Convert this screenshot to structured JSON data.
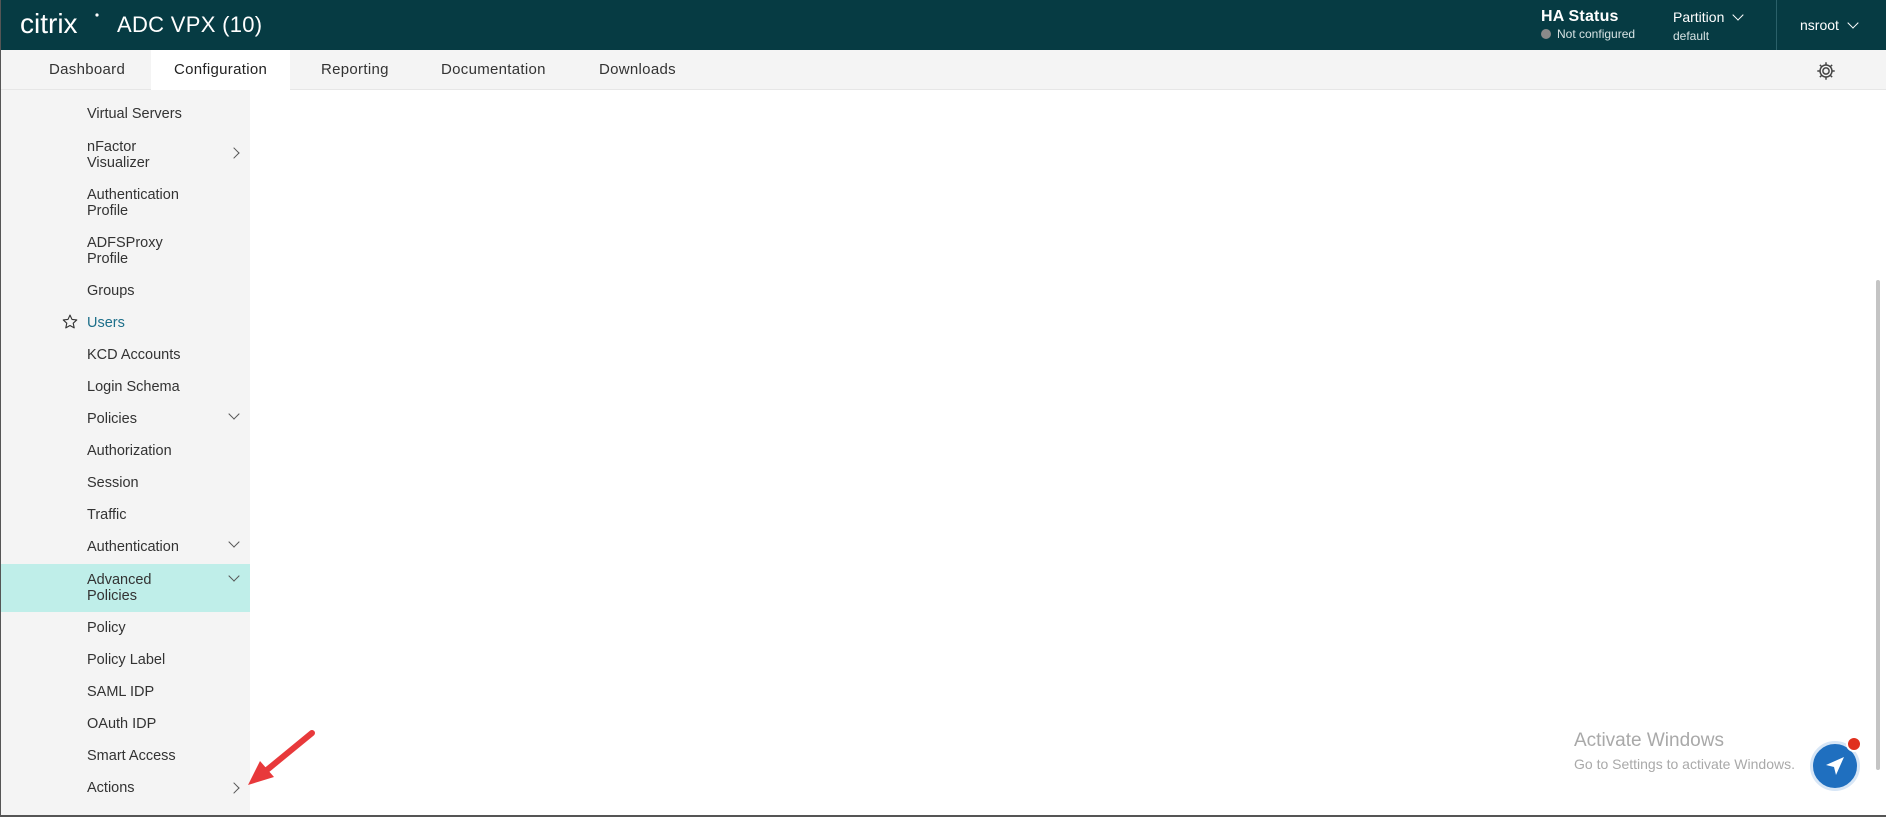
{
  "header": {
    "logo_text": "citrix",
    "app_title": "ADC VPX (10)",
    "ha_status_label": "HA Status",
    "ha_status_value": "Not configured",
    "partition_label": "Partition",
    "partition_value": "default",
    "user": "nsroot"
  },
  "nav": {
    "tabs": [
      {
        "label": "Dashboard"
      },
      {
        "label": "Configuration"
      },
      {
        "label": "Reporting"
      },
      {
        "label": "Documentation"
      },
      {
        "label": "Downloads"
      }
    ],
    "active_tab": "Configuration",
    "settings_icon": "gear-icon"
  },
  "sidebar": {
    "items": [
      {
        "label": "Virtual Servers"
      },
      {
        "label": "nFactor Visualizer",
        "expander": "chevron-right-icon"
      },
      {
        "label": "Authentication Profile"
      },
      {
        "label": "ADFSProxy Profile"
      },
      {
        "label": "Groups"
      },
      {
        "label": "Users",
        "state": "active",
        "icon": "star-icon"
      },
      {
        "label": "KCD Accounts"
      },
      {
        "label": "Login Schema"
      },
      {
        "label": "Policies",
        "expander": "chevron-down-icon"
      },
      {
        "label": "Authorization"
      },
      {
        "label": "Session"
      },
      {
        "label": "Traffic"
      },
      {
        "label": "Authentication",
        "expander": "chevron-down-icon"
      },
      {
        "label": "Advanced Policies",
        "expander": "chevron-down-icon",
        "state": "selected"
      },
      {
        "label": "Policy"
      },
      {
        "label": "Policy Label"
      },
      {
        "label": "SAML IDP"
      },
      {
        "label": "OAuth IDP"
      },
      {
        "label": "Smart Access"
      },
      {
        "label": "Actions",
        "expander": "chevron-right-icon"
      }
    ]
  },
  "watermark": {
    "title": "Activate Windows",
    "subtitle": "Go to Settings to activate Windows."
  },
  "colors": {
    "header_bg": "#063b43",
    "selected_item_bg": "#bfeee9",
    "active_item_text": "#1d6f8a",
    "fab_bg": "#1f6fbf",
    "annotation_arrow": "#e8393b"
  }
}
